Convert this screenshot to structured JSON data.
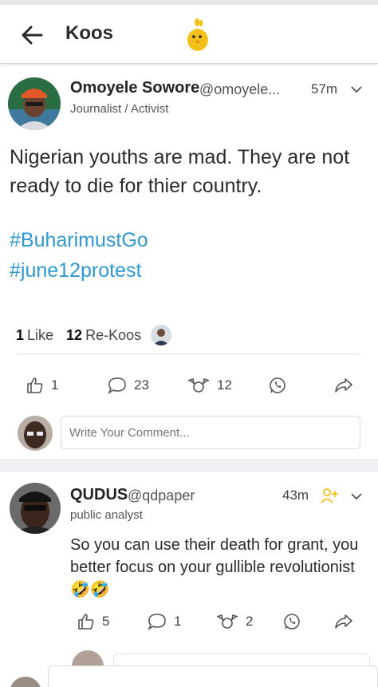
{
  "header": {
    "title": "Koos",
    "logo_icon": "yellow-chick-logo"
  },
  "post": {
    "author_name": "Omoyele Sowore",
    "author_handle": "@omoyele...",
    "time": "57m",
    "author_role": "Journalist / Activist",
    "text": "Nigerian youths are mad. They are not ready to die for thier country.",
    "hashtags": [
      "#BuharimustGo",
      "#june12protest"
    ],
    "stats": {
      "likes_count": "1",
      "likes_label": "Like",
      "rekoos_count": "12",
      "rekoos_label": "Re-Koos"
    },
    "actions": {
      "like_count": "1",
      "comment_count": "23",
      "rekoo_count": "12"
    },
    "comment_placeholder": "Write Your Comment..."
  },
  "reply": {
    "author_name": "QUDUS",
    "author_handle": "@qdpaper",
    "time": "43m",
    "author_role": "public analyst",
    "text": "So you can use their death for grant, you better focus on your gullible revolutionist 🤣🤣",
    "actions": {
      "like_count": "5",
      "comment_count": "1",
      "rekoo_count": "2"
    }
  },
  "colors": {
    "hashtag": "#2f98d0",
    "accent_yellow": "#f2c21b",
    "icon_gray": "#555555"
  }
}
